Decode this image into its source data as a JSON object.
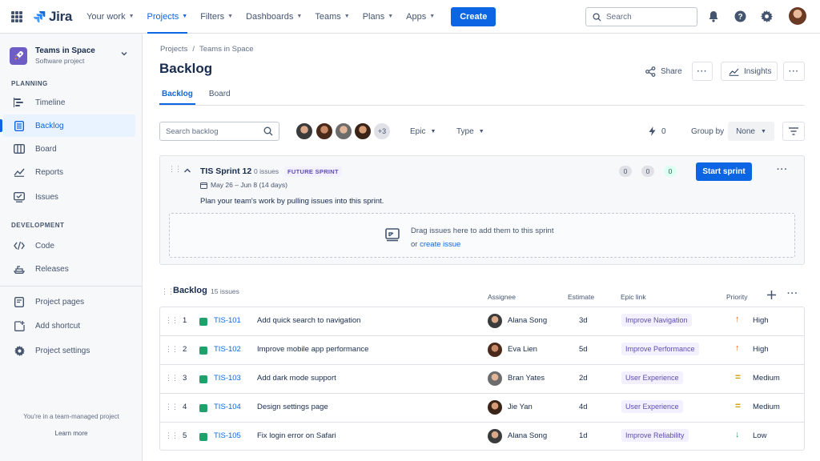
{
  "app": {
    "name": "Jira"
  },
  "topnav": {
    "items": [
      {
        "label": "Your work"
      },
      {
        "label": "Projects"
      },
      {
        "label": "Filters"
      },
      {
        "label": "Dashboards"
      },
      {
        "label": "Teams"
      },
      {
        "label": "Plans"
      },
      {
        "label": "Apps"
      }
    ],
    "create_label": "Create",
    "search_placeholder": "Search"
  },
  "sidebar": {
    "project_name": "Teams in Space",
    "project_type": "Software project",
    "planning_label": "PLANNING",
    "planning_items": [
      {
        "label": "Timeline",
        "icon": "timeline-icon"
      },
      {
        "label": "Backlog",
        "icon": "backlog-icon"
      },
      {
        "label": "Board",
        "icon": "board-icon"
      },
      {
        "label": "Reports",
        "icon": "reports-icon"
      },
      {
        "label": "Issues",
        "icon": "issues-icon"
      }
    ],
    "development_label": "DEVELOPMENT",
    "development_items": [
      {
        "label": "Code",
        "icon": "code-icon"
      },
      {
        "label": "Releases",
        "icon": "releases-icon"
      }
    ],
    "other_items": [
      {
        "label": "Project pages",
        "icon": "pages-icon"
      },
      {
        "label": "Add shortcut",
        "icon": "add-shortcut-icon"
      },
      {
        "label": "Project settings",
        "icon": "gear-icon"
      }
    ],
    "footer_text": "You're in a team-managed project",
    "learn_more": "Learn more"
  },
  "main": {
    "breadcrumb": [
      "Projects",
      "Teams in Space"
    ],
    "title": "Backlog",
    "share_label": "Share",
    "insights_label": "Insights",
    "tabs": [
      {
        "label": "Backlog"
      },
      {
        "label": "Board"
      }
    ],
    "search_placeholder": "Search backlog",
    "avatars_more": "+3",
    "epic_filter": "Epic",
    "type_filter": "Type",
    "bolt_count": "0",
    "group_by_label": "Group by",
    "group_by_value": "None"
  },
  "sprint": {
    "name": "TIS Sprint 12",
    "issue_count": "0 issues",
    "status": "FUTURE SPRINT",
    "dates": "May 26 – Jun 8 (14 days)",
    "goal": "Plan your team's work by pulling issues into this sprint.",
    "todo": "0",
    "in_progress": "0",
    "done": "0",
    "start_label": "Start sprint",
    "drop_text": "Drag issues here to add them to this sprint",
    "drop_or": "or",
    "drop_link": "create issue"
  },
  "backlog": {
    "title": "Backlog",
    "count": "15 issues",
    "columns": {
      "assignee": "Assignee",
      "estimate": "Estimate",
      "epic": "Epic link",
      "priority": "Priority"
    },
    "rows": [
      {
        "num": "1",
        "key": "TIS-101",
        "summary": "Add quick search to navigation",
        "assignee": "Alana Song",
        "estimate": "3d",
        "epic": "Improve Navigation",
        "priority": "High"
      },
      {
        "num": "2",
        "key": "TIS-102",
        "summary": "Improve mobile app performance",
        "assignee": "Eva Lien",
        "estimate": "5d",
        "epic": "Improve Performance",
        "priority": "High"
      },
      {
        "num": "3",
        "key": "TIS-103",
        "summary": "Add dark mode support",
        "assignee": "Bran Yates",
        "estimate": "2d",
        "epic": "User Experience",
        "priority": "Medium"
      },
      {
        "num": "4",
        "key": "TIS-104",
        "summary": "Design settings page",
        "assignee": "Jie Yan",
        "estimate": "4d",
        "epic": "User Experience",
        "priority": "Medium"
      },
      {
        "num": "5",
        "key": "TIS-105",
        "summary": "Fix login error on Safari",
        "assignee": "Alana Song",
        "estimate": "1d",
        "epic": "Improve Reliability",
        "priority": "Low"
      }
    ]
  },
  "colors": {
    "accent": "#0c66e4",
    "priority_high": "#e56910",
    "priority_medium": "#cf9f02",
    "priority_low": "#22a06b",
    "epic_bg": "#f3f0ff",
    "epic_text": "#5e4db2"
  }
}
